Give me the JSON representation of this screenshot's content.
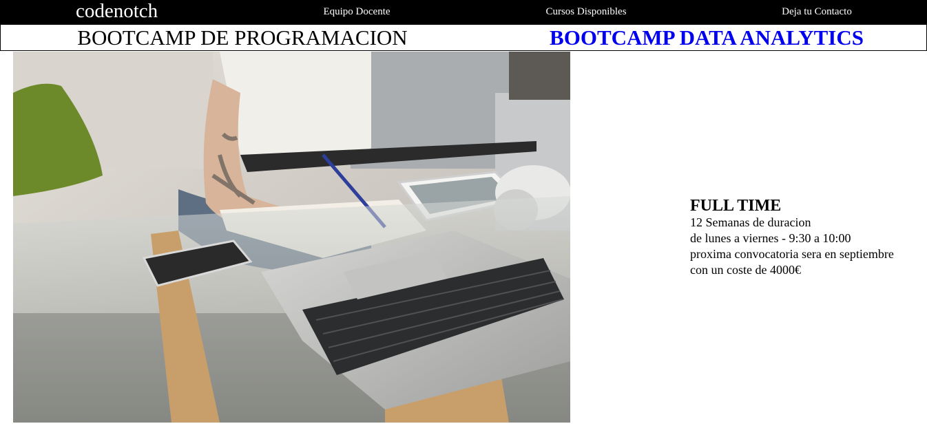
{
  "header": {
    "brand": "codenotch",
    "nav": [
      {
        "label": "Equipo Docente"
      },
      {
        "label": "Cursos Disponibles"
      },
      {
        "label": "Deja tu Contacto"
      }
    ]
  },
  "courses": [
    {
      "label": "BOOTCAMP DE PROGRAMACION"
    },
    {
      "label": "BOOTCAMP DATA ANALYTICS",
      "active": true
    }
  ],
  "hero": {
    "description": "Person with tattooed arm writing in a notebook next to a laptop, tablet, phone and headphones on a glass table"
  },
  "details": {
    "title": "FULL TIME",
    "lines": [
      "12 Semanas de duracion",
      "de lunes a viernes - 9:30 a 10:00",
      "proxima convocatoria sera en septiembre",
      "con un coste de 4000€"
    ]
  },
  "colors": {
    "topbar": "#000000",
    "active_course": "#0000ee"
  }
}
